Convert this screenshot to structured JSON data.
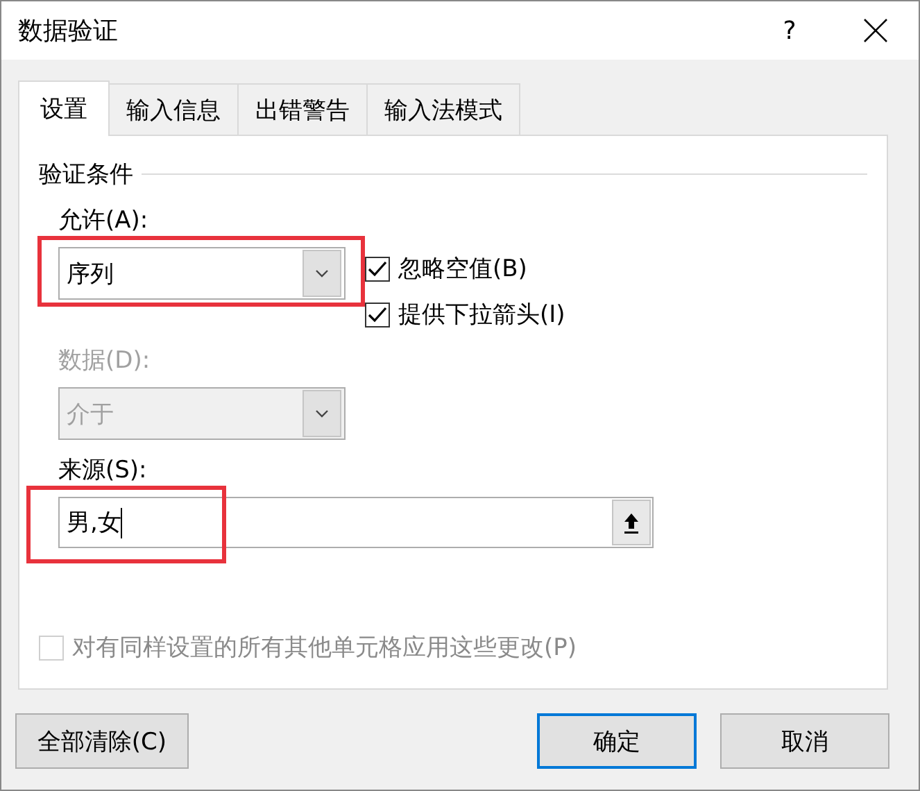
{
  "window": {
    "title": "数据验证",
    "help": "?"
  },
  "tabs": [
    {
      "label": "设置",
      "selected": true
    },
    {
      "label": "输入信息",
      "selected": false
    },
    {
      "label": "出错警告",
      "selected": false
    },
    {
      "label": "输入法模式",
      "selected": false
    }
  ],
  "section_title": "验证条件",
  "allow": {
    "label": "允许(A):",
    "value": "序列",
    "highlighted": true
  },
  "checkboxes": [
    {
      "label": "忽略空值(B)",
      "checked": true
    },
    {
      "label": "提供下拉箭头(I)",
      "checked": true
    }
  ],
  "data": {
    "label": "数据(D):",
    "value": "介于",
    "disabled": true
  },
  "source": {
    "label": "来源(S):",
    "value": "男,女",
    "highlighted": true
  },
  "apply_all": {
    "label": "对有同样设置的所有其他单元格应用这些更改(P)",
    "checked": false,
    "disabled": true
  },
  "buttons": [
    {
      "label": "全部清除(C)",
      "default": false
    },
    {
      "label": "确定",
      "default": true
    },
    {
      "label": "取消",
      "default": false
    }
  ]
}
